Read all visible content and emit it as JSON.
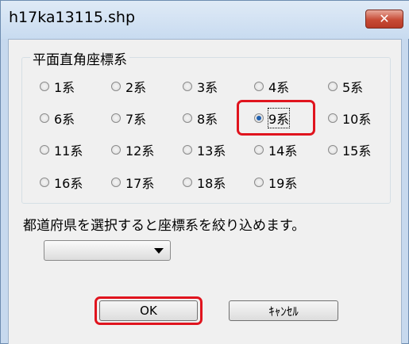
{
  "window": {
    "title": "h17ka13115.shp",
    "close_glyph": "✕"
  },
  "group": {
    "legend": "平面直角座標系",
    "options": [
      "1系",
      "2系",
      "3系",
      "4系",
      "5系",
      "6系",
      "7系",
      "8系",
      "9系",
      "10系",
      "11系",
      "12系",
      "13系",
      "14系",
      "15系",
      "16系",
      "17系",
      "18系",
      "19系"
    ],
    "selected": "9系"
  },
  "hint": "都道府県を選択すると座標系を絞り込めます。",
  "prefecture_select": {
    "value": ""
  },
  "buttons": {
    "ok": "OK",
    "cancel": "ｷｬﾝｾﾙ"
  },
  "colors": {
    "highlight": "#e0141e",
    "radio_dot": "#1f5fae",
    "close_button": "#c74b36"
  },
  "icons": {
    "close": "close-icon",
    "dropdown": "chevron-down-icon"
  }
}
